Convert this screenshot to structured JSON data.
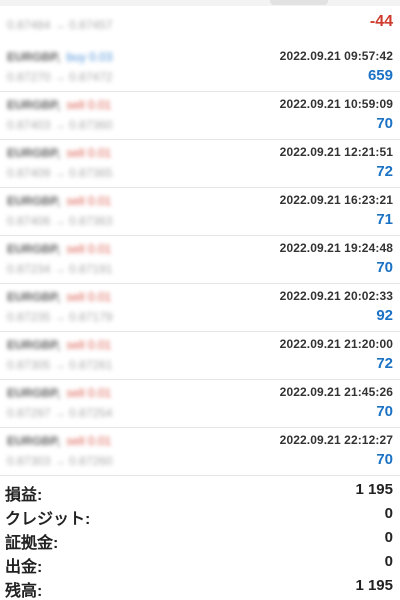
{
  "partial_row": {
    "prices": "0.87484 → 0.87457",
    "profit": "-44"
  },
  "trades": [
    {
      "symbol": "EURGBP,",
      "direction": "buy 0.03",
      "dir_type": "buy",
      "prices": "0.87270 → 0.87472",
      "time": "2022.09.21 09:57:42",
      "profit": "659"
    },
    {
      "symbol": "EURGBP,",
      "direction": "sell 0.01",
      "dir_type": "sell",
      "prices": "0.87403 → 0.87360",
      "time": "2022.09.21 10:59:09",
      "profit": "70"
    },
    {
      "symbol": "EURGBP,",
      "direction": "sell 0.01",
      "dir_type": "sell",
      "prices": "0.87409 → 0.87365",
      "time": "2022.09.21 12:21:51",
      "profit": "72"
    },
    {
      "symbol": "EURGBP,",
      "direction": "sell 0.01",
      "dir_type": "sell",
      "prices": "0.87406 → 0.87363",
      "time": "2022.09.21 16:23:21",
      "profit": "71"
    },
    {
      "symbol": "EURGBP,",
      "direction": "sell 0.01",
      "dir_type": "sell",
      "prices": "0.87234 → 0.87191",
      "time": "2022.09.21 19:24:48",
      "profit": "70"
    },
    {
      "symbol": "EURGBP,",
      "direction": "sell 0.01",
      "dir_type": "sell",
      "prices": "0.87235 → 0.87179",
      "time": "2022.09.21 20:02:33",
      "profit": "92"
    },
    {
      "symbol": "EURGBP,",
      "direction": "sell 0.01",
      "dir_type": "sell",
      "prices": "0.87305 → 0.87261",
      "time": "2022.09.21 21:20:00",
      "profit": "72"
    },
    {
      "symbol": "EURGBP,",
      "direction": "sell 0.01",
      "dir_type": "sell",
      "prices": "0.87297 → 0.87254",
      "time": "2022.09.21 21:45:26",
      "profit": "70"
    },
    {
      "symbol": "EURGBP,",
      "direction": "sell 0.01",
      "dir_type": "sell",
      "prices": "0.87303 → 0.87260",
      "time": "2022.09.21 22:12:27",
      "profit": "70"
    }
  ],
  "summary": [
    {
      "key": "profit",
      "label": "損益:",
      "value": "1 195"
    },
    {
      "key": "credit",
      "label": "クレジット:",
      "value": "0"
    },
    {
      "key": "margin",
      "label": "証拠金:",
      "value": "0"
    },
    {
      "key": "withdrawal",
      "label": "出金:",
      "value": "0"
    },
    {
      "key": "balance",
      "label": "残高:",
      "value": "1 195"
    }
  ],
  "colors": {
    "profit_positive": "#1a72c4",
    "profit_negative": "#cf3b2d",
    "buy": "#2c7dd1",
    "sell": "#d23c2c"
  }
}
